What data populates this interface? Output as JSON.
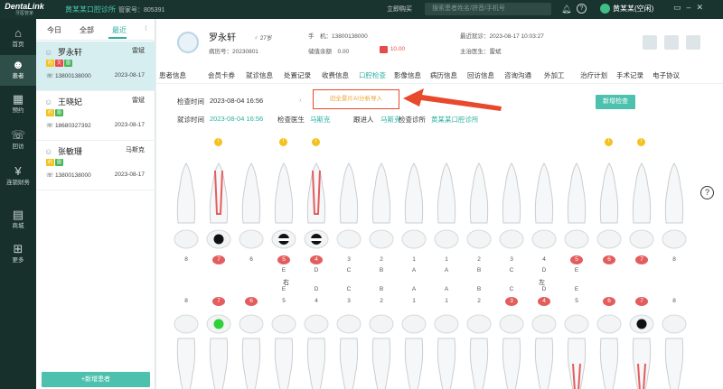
{
  "titlebar": {
    "logo": "DentaLink",
    "logo_sub": "牙医管家",
    "clinic": "黄某某口腔诊所",
    "manager": "管家号：805391",
    "center": "立即购买",
    "search_placeholder": "搜索患者姓名/拼音/手机号",
    "user": "黄某某(空闲)"
  },
  "nav": [
    {
      "icon": "⌂",
      "label": "首页"
    },
    {
      "icon": "☻",
      "label": "患者"
    },
    {
      "icon": "▦",
      "label": "预约"
    },
    {
      "icon": "☏",
      "label": "回访"
    },
    {
      "icon": "¥",
      "label": "连锁财务"
    },
    {
      "icon": "▤",
      "label": "商城"
    },
    {
      "icon": "⊞",
      "label": "更多"
    }
  ],
  "patient_tabs": [
    "今日",
    "全部",
    "最近"
  ],
  "patients": [
    {
      "name": "罗永轩",
      "doctor": "雷斌",
      "phone": "13800138000",
      "date": "2023-08-17"
    },
    {
      "name": "王晓妃",
      "doctor": "雷斌",
      "phone": "18680327392",
      "date": "2023-08-17"
    },
    {
      "name": "张敏珊",
      "doctor": "马斯克",
      "phone": "13800138000",
      "date": "2023-08-17"
    }
  ],
  "add_patient": "+新增患者",
  "header": {
    "name": "罗永轩",
    "gender_age": "27岁",
    "case_no": "病历号：20230801",
    "phone_label": "手　机：",
    "phone": "13800138000",
    "balance_label": "储值余额",
    "balance": "0.00",
    "arrears": "10.00",
    "last_visit": "最近就诊：2023-08-17 10:03:27",
    "doctor": "主治医生：雷斌"
  },
  "tabs": [
    "患者信息",
    "会员卡券",
    "就诊信息",
    "处置记录",
    "收费信息",
    "口腔检查",
    "影像信息",
    "病历信息",
    "回访信息",
    "咨询沟通",
    "外加工",
    "治疗计划",
    "手术记录",
    "电子协议"
  ],
  "exam": {
    "check_time_label": "检查时间",
    "check_time": "2023-08-04 16:56",
    "ai_button": "旧全景片AI分析导入",
    "new_check": "新增检查",
    "visit_time_label": "就诊时间",
    "visit_time": "2023-08-04 16:56",
    "doctor_label": "检查医生",
    "doctor": "马斯克",
    "follower_label": "跟进人",
    "follower": "马斯克",
    "clinic_label": "检查诊所",
    "clinic": "黄某某口腔诊所"
  },
  "chart": {
    "right_label": "右",
    "left_label": "左",
    "upper_numbers": [
      "8",
      "7",
      "6",
      "5",
      "4",
      "3",
      "2",
      "1",
      "1",
      "2",
      "3",
      "4",
      "5",
      "6",
      "7",
      "8"
    ],
    "upper_red": [
      false,
      true,
      false,
      true,
      true,
      false,
      false,
      false,
      false,
      false,
      false,
      false,
      true,
      true,
      true,
      false
    ],
    "upper_letters": [
      "",
      "",
      "",
      "E",
      "D",
      "C",
      "B",
      "A",
      "A",
      "B",
      "C",
      "D",
      "E",
      "",
      "",
      ""
    ],
    "lower_letters": [
      "",
      "",
      "",
      "E",
      "D",
      "C",
      "B",
      "A",
      "A",
      "B",
      "C",
      "D",
      "E",
      "",
      "",
      ""
    ],
    "lower_numbers": [
      "8",
      "7",
      "6",
      "5",
      "4",
      "3",
      "2",
      "1",
      "1",
      "2",
      "3",
      "4",
      "5",
      "6",
      "7",
      "8"
    ],
    "lower_red": [
      false,
      true,
      true,
      false,
      false,
      false,
      false,
      false,
      false,
      false,
      true,
      true,
      false,
      true,
      true,
      false
    ],
    "upper_marks": [
      false,
      true,
      false,
      true,
      true,
      false,
      false,
      false,
      false,
      false,
      false,
      false,
      false,
      true,
      true,
      false
    ]
  },
  "colors": {
    "accent": "#2ab1a0",
    "nav_bg": "#18302c",
    "red": "#e35d5d",
    "mark": "#f4c21f"
  }
}
